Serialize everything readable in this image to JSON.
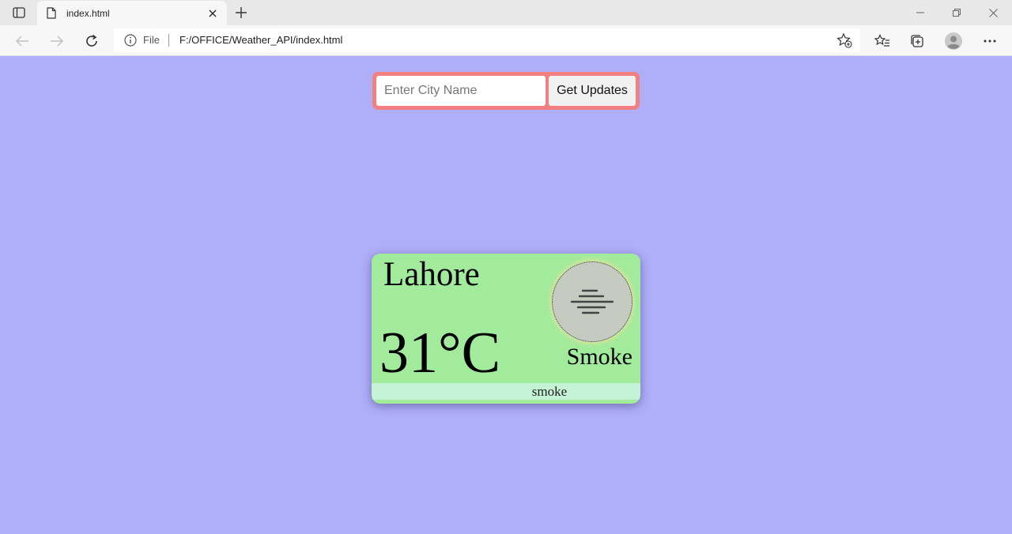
{
  "browser": {
    "tab_title": "index.html",
    "address_scheme": "File",
    "address_url": "F:/OFFICE/Weather_API/index.html"
  },
  "search": {
    "placeholder": "Enter City Name",
    "value": "",
    "button_label": "Get Updates"
  },
  "weather": {
    "city": "Lahore",
    "temperature": "31°C",
    "condition": "Smoke",
    "description": "smoke",
    "icon": "smoke-haze-icon"
  },
  "colors": {
    "page_background": "#afaef8",
    "search_border": "#f28080",
    "card_background": "#a2ea9c",
    "description_bar": "#c3f2d4",
    "icon_circle": "#c6cbc2"
  }
}
